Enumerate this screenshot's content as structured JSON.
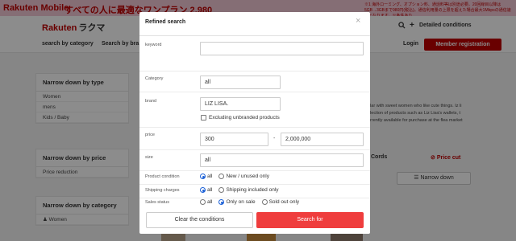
{
  "banner": {
    "logo": "Rakuten Mobile",
    "catch": "すべての人に最適なワンプラン",
    "price": "2,980",
    "right_text": "※1 海外ローミング、オプション料、通話料等は別途必要。20回線目以降は5GB→3GBまで980円(税込)。通信利用量の上限を超えた場合最大1Mbpsの通信速度となります。※条件あり"
  },
  "header": {
    "logo": "Rakuten",
    "logo_sub": "ラクマ",
    "detailed_conditions": "Detailed conditions"
  },
  "nav": {
    "search_by_category": "search by category",
    "search_by_brand": "Search by bra",
    "login": "Login",
    "member_registration": "Member registration"
  },
  "sidebar": {
    "type_panel": {
      "title": "Narrow down by type",
      "items": [
        "Women",
        "mens",
        "Kids / Baby"
      ]
    },
    "price_panel": {
      "title": "Narrow down by price",
      "items": [
        "Price reduction"
      ]
    },
    "category_panel": {
      "title": "Narrow down by category",
      "items": [
        "Women"
      ]
    }
  },
  "main": {
    "description": "ular with sweet women who like cute things. Iz li election of products such as Liz Lisa's wallets, t urrently available for purchase at the flea market",
    "cords": "Cords",
    "price_cut": "Price cut",
    "narrow_down": "Narrow down"
  },
  "modal": {
    "title": "Refined search",
    "close": "×",
    "keyword": {
      "label": "keyword",
      "value": ""
    },
    "category": {
      "label": "Category",
      "value": "all"
    },
    "brand": {
      "label": "brand",
      "value": "LIZ LISA.",
      "exclude_label": "Excluding unbranded products"
    },
    "price": {
      "label": "price",
      "min": "300",
      "separator": "-",
      "max": "2,000,000"
    },
    "size": {
      "label": "size",
      "value": "all"
    },
    "product_condition": {
      "label": "Product condition",
      "options": [
        "all",
        "New / unused only"
      ],
      "selected": "all"
    },
    "shipping_charges": {
      "label": "Shipping charges",
      "options": [
        "all",
        "Shipping included only"
      ],
      "selected": "all"
    },
    "sales_status": {
      "label": "Sales status",
      "options": [
        "all",
        "Only on sale",
        "Sold out only"
      ],
      "selected": "Only on sale"
    },
    "clear_button": "Clear the conditions",
    "search_button": "Search for"
  },
  "colors": {
    "brand_red": "#bf0000",
    "search_button": "#ef3d3d",
    "radio_selected": "#1a5fd6"
  }
}
